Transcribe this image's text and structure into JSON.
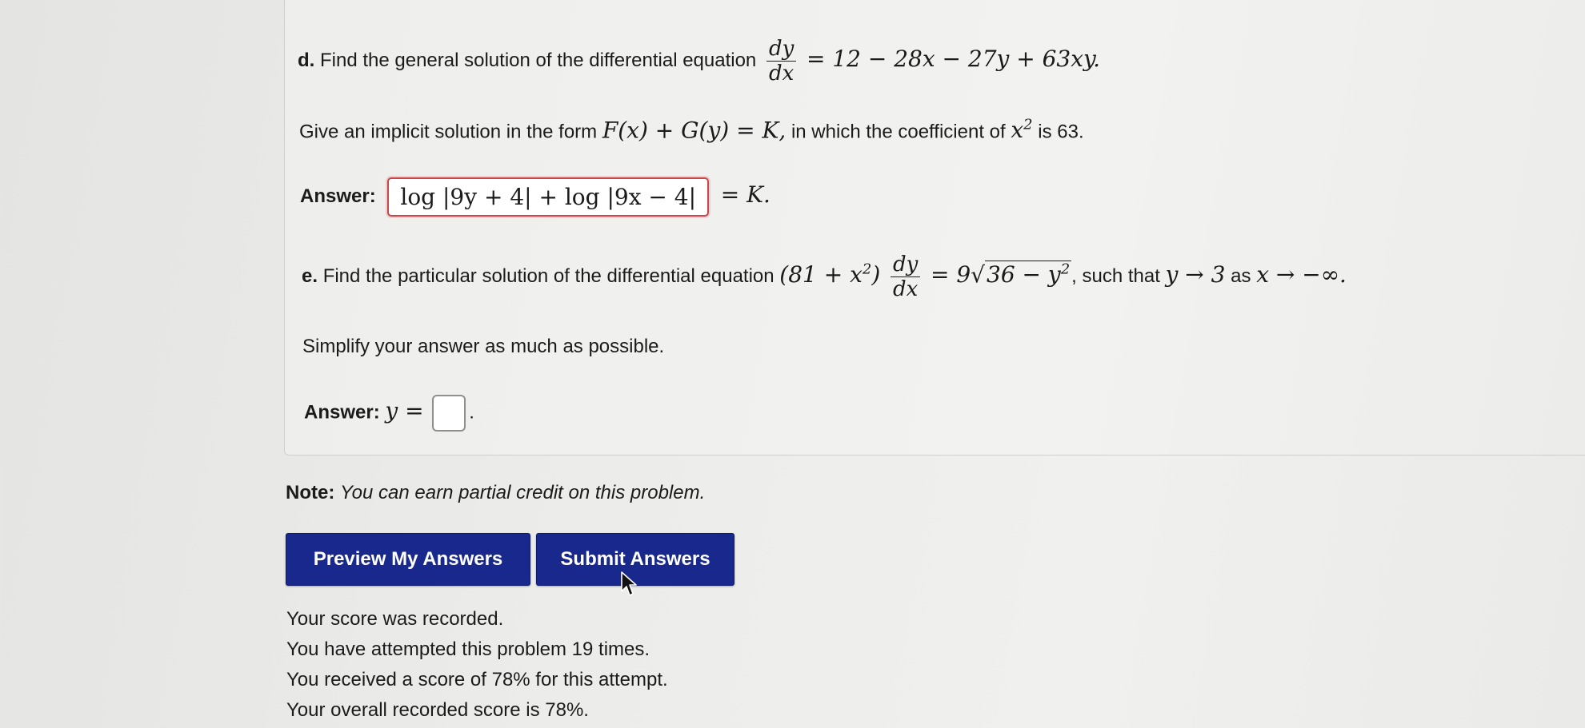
{
  "part_d": {
    "label": "d.",
    "text": "Find the general solution of the differential equation",
    "frac_num": "dy",
    "frac_den": "dx",
    "rhs": "= 12 − 28x − 27y + 63xy."
  },
  "part_d_instruction": {
    "text_before": "Give an implicit solution in the form",
    "form": "F(x) + G(y) = K,",
    "text_mid": "in which the coefficient of",
    "var": "x",
    "exp": "2",
    "text_after": "is 63."
  },
  "answer_d": {
    "label": "Answer:",
    "value": "log |9y + 4| + log |9x − 4|",
    "suffix": "= K."
  },
  "part_e": {
    "label": "e.",
    "text": "Find the particular solution of the differential equation",
    "lhs_factor": "(81 + x",
    "lhs_exp": "2",
    "lhs_close": ")",
    "frac_num": "dy",
    "frac_den": "dx",
    "eq_coeff": "= 9",
    "radicand": "36 − y",
    "radicand_exp": "2",
    "condition_prefix": ", such that",
    "condition_y": "y → 3",
    "condition_mid": "as",
    "condition_x": "x → −∞."
  },
  "part_e_instruction": "Simplify your answer as much as possible.",
  "answer_e": {
    "label": "Answer:",
    "lhs": "y =",
    "value": "",
    "suffix": "."
  },
  "note": {
    "label": "Note:",
    "text": "You can earn partial credit on this problem."
  },
  "buttons": {
    "preview": "Preview My Answers",
    "submit": "Submit Answers"
  },
  "score": {
    "line1": "Your score was recorded.",
    "line2": "You have attempted this problem 19 times.",
    "line3": "You received a score of 78% for this attempt.",
    "line4": "Your overall recorded score is 78%."
  },
  "colors": {
    "button_bg": "#19288d",
    "answer_border": "#c9474b"
  }
}
